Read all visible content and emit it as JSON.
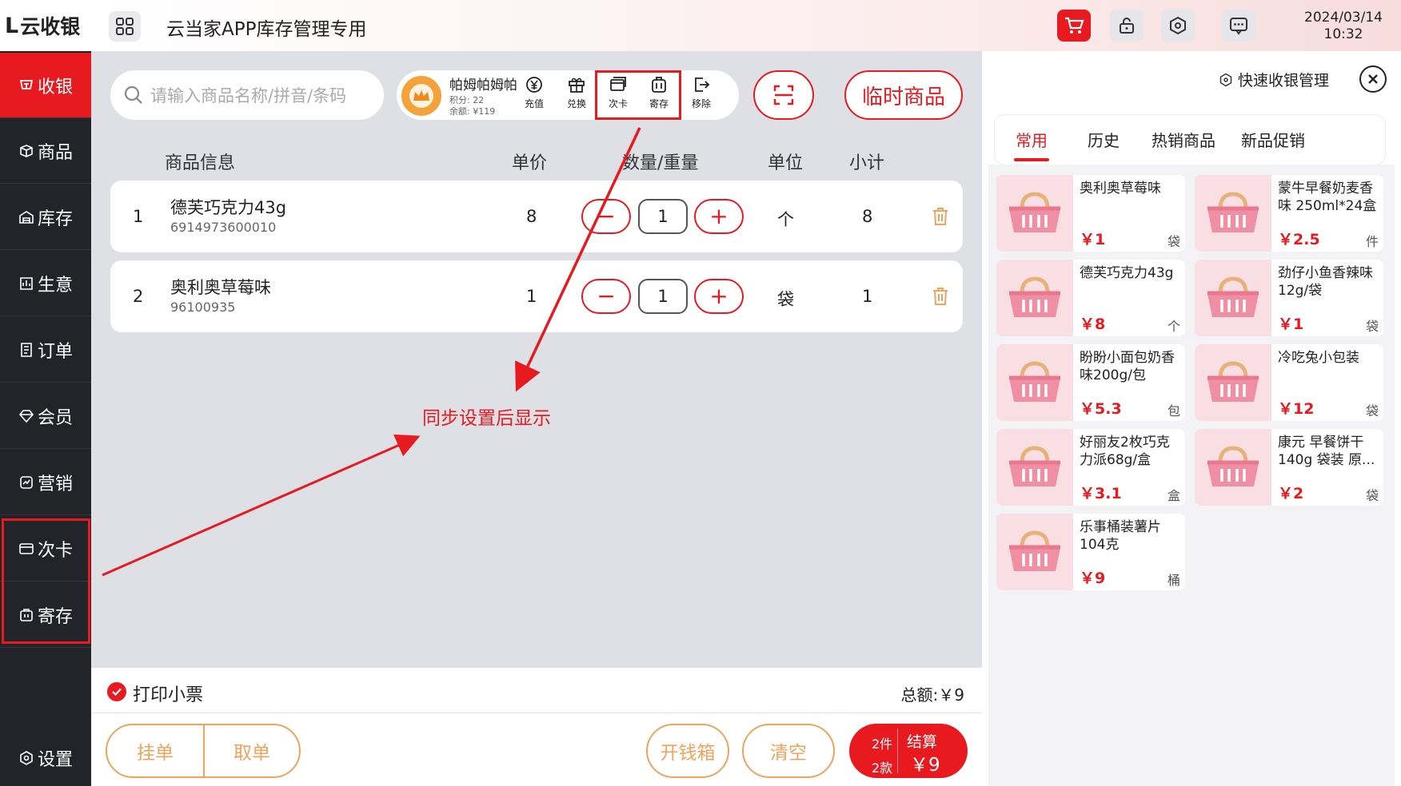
{
  "brand": {
    "logo_mark": "L",
    "name": "云收银"
  },
  "sidebar": {
    "items": [
      {
        "label": "收银",
        "icon": "cashier-icon"
      },
      {
        "label": "商品",
        "icon": "box-icon"
      },
      {
        "label": "库存",
        "icon": "warehouse-icon"
      },
      {
        "label": "生意",
        "icon": "business-icon"
      },
      {
        "label": "订单",
        "icon": "order-icon"
      },
      {
        "label": "会员",
        "icon": "member-icon"
      },
      {
        "label": "营销",
        "icon": "marketing-icon"
      },
      {
        "label": "次卡",
        "icon": "card-icon"
      },
      {
        "label": "寄存",
        "icon": "storage-icon"
      }
    ],
    "settings_label": "设置"
  },
  "header": {
    "title": "云当家APP库存管理专用",
    "date": "2024/03/14",
    "time": "10:32"
  },
  "search": {
    "placeholder": "请输入商品名称/拼音/条码"
  },
  "member": {
    "name": "帕姆帕姆帕",
    "points": "积分: 22",
    "balance": "余额: ¥119",
    "actions": [
      "充值",
      "兑换",
      "次卡",
      "寄存",
      "移除"
    ]
  },
  "temp_product_label": "临时商品",
  "table": {
    "headers": [
      "商品信息",
      "单价",
      "数量/重量",
      "单位",
      "小计"
    ],
    "rows": [
      {
        "idx": "1",
        "name": "德芙巧克力43g",
        "code": "6914973600010",
        "price": "8",
        "qty": "1",
        "unit": "个",
        "subtotal": "8"
      },
      {
        "idx": "2",
        "name": "奥利奥草莓味",
        "code": "96100935",
        "price": "1",
        "qty": "1",
        "unit": "袋",
        "subtotal": "1"
      }
    ]
  },
  "annotation": "同步设置后显示",
  "footer": {
    "print_label": "打印小票",
    "total": "总额:￥9",
    "hold": "挂单",
    "retrieve": "取单",
    "cash_drawer": "开钱箱",
    "clear": "清空",
    "items_count": "2件",
    "kinds_count": "2款",
    "checkout_label": "结算",
    "checkout_amount": "￥9"
  },
  "right_panel": {
    "quick_manage": "快速收银管理",
    "tabs": [
      "常用",
      "历史",
      "热销商品",
      "新品促销"
    ],
    "products": [
      {
        "name": "奥利奥草莓味",
        "price": "￥1",
        "unit": "袋"
      },
      {
        "name": "蒙牛早餐奶麦香味 250ml*24盒",
        "price": "￥2.5",
        "unit": "件"
      },
      {
        "name": "德芙巧克力43g",
        "price": "￥8",
        "unit": "个"
      },
      {
        "name": "劲仔小鱼香辣味12g/袋",
        "price": "￥1",
        "unit": "袋"
      },
      {
        "name": "盼盼小面包奶香味200g/包",
        "price": "￥5.3",
        "unit": "包"
      },
      {
        "name": "冷吃兔小包装",
        "price": "￥12",
        "unit": "袋"
      },
      {
        "name": "好丽友2枚巧克力派68g/盒",
        "price": "￥3.1",
        "unit": "盒"
      },
      {
        "name": "康元 早餐饼干140g 袋装 原...",
        "price": "￥2",
        "unit": "袋"
      },
      {
        "name": "乐事桶装薯片104克",
        "price": "￥9",
        "unit": "桶"
      }
    ]
  },
  "colors": {
    "accent": "#e8191f",
    "sidebar_bg": "#23242a",
    "orange": "#f0a35c"
  }
}
